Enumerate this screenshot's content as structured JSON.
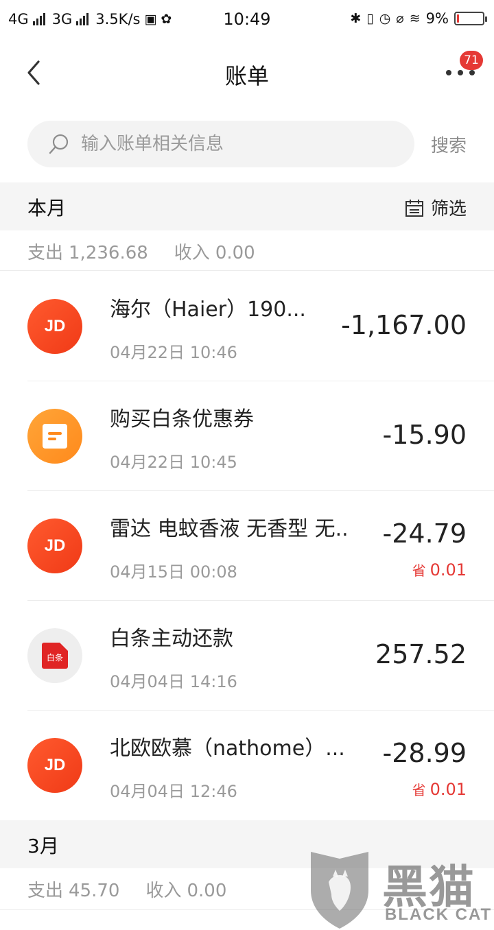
{
  "status_bar": {
    "network1": "4G",
    "network2": "3G",
    "speed": "3.5K/s",
    "time": "10:49",
    "battery_percent": "9%",
    "battery_level": 0.09
  },
  "nav": {
    "title": "账单",
    "badge": "71"
  },
  "search": {
    "placeholder": "输入账单相关信息",
    "button": "搜索"
  },
  "sections": [
    {
      "title": "本月",
      "filter_label": "筛选",
      "expense_label": "支出",
      "expense": "1,236.68",
      "income_label": "收入",
      "income": "0.00"
    },
    {
      "title": "3月",
      "expense_label": "支出",
      "expense": "45.70",
      "income_label": "收入",
      "income": "0.00"
    }
  ],
  "transactions": [
    {
      "title": "海尔（Haier）190...",
      "time": "04月22日 10:46",
      "amount": "-1,167.00",
      "avatar": "JD"
    },
    {
      "title": "购买白条优惠券",
      "time": "04月22日 10:45",
      "amount": "-15.90",
      "avatar": "coupon-icon"
    },
    {
      "title": "雷达 电蚊香液 无香型 无..",
      "time": "04月15日 00:08",
      "amount": "-24.79",
      "saving_label": "省",
      "saving": "0.01",
      "avatar": "JD"
    },
    {
      "title": "白条主动还款",
      "time": "04月04日 14:16",
      "amount": "257.52",
      "avatar": "白条"
    },
    {
      "title": "北欧欧慕（nathome）...",
      "time": "04月04日 12:46",
      "amount": "-28.99",
      "saving_label": "省",
      "saving": "0.01",
      "avatar": "JD"
    }
  ],
  "watermark": {
    "cn": "黑猫",
    "en": "BLACK CAT"
  },
  "colors": {
    "accent_red": "#e53935",
    "jd_orange": "#f03a17",
    "coupon_orange": "#ff8a1c",
    "section_bg": "#f5f5f5"
  }
}
